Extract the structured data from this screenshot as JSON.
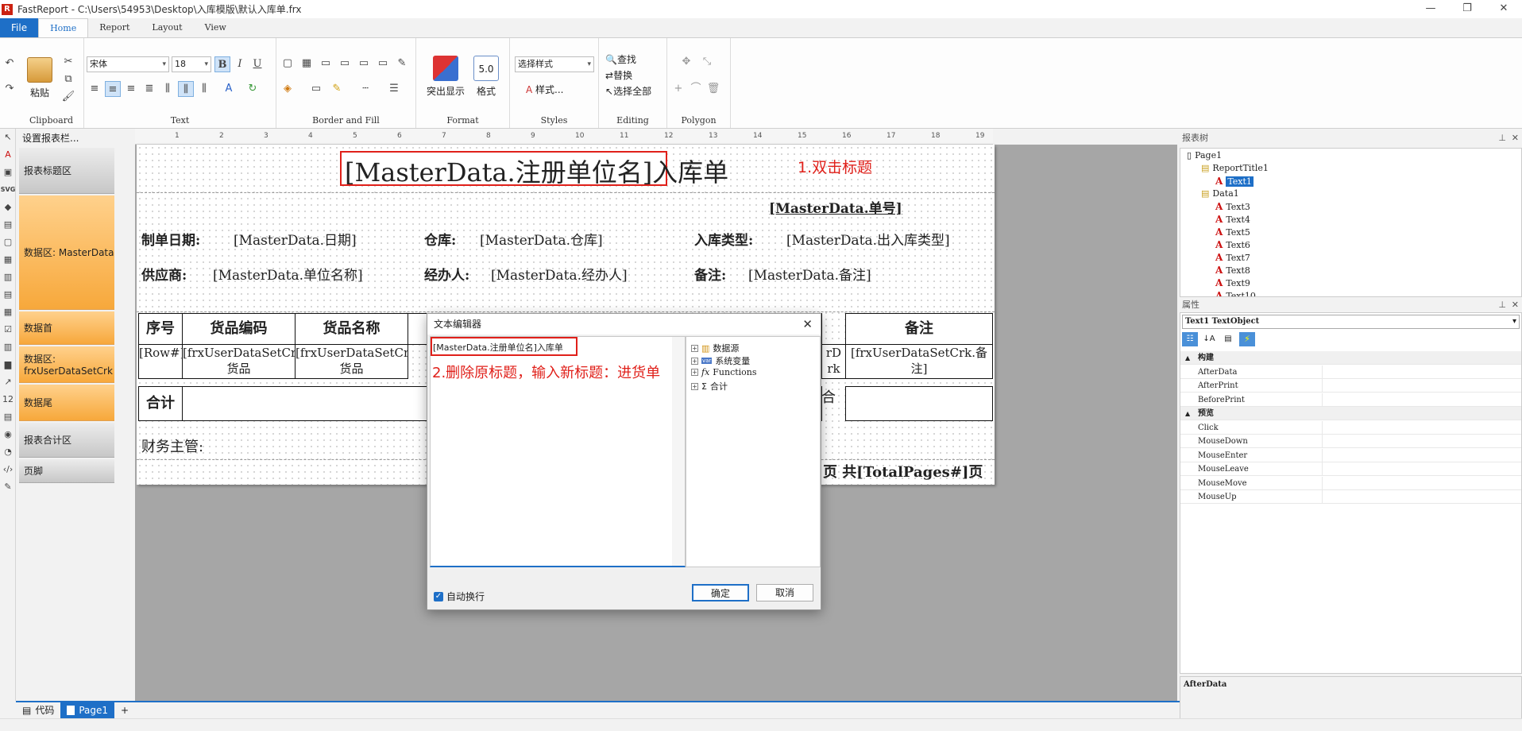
{
  "window": {
    "title": "FastReport - C:\\Users\\54953\\Desktop\\入库模版\\默认入库单.frx",
    "logo": "R",
    "controls": {
      "minimize": "—",
      "maximize": "❐",
      "close": "✕"
    }
  },
  "menu": {
    "tabs": [
      "File",
      "Home",
      "Report",
      "Layout",
      "View"
    ],
    "active": "Home"
  },
  "ribbon": {
    "clipboard": {
      "label": "Clipboard",
      "paste": "粘贴"
    },
    "text": {
      "label": "Text",
      "font": "宋体",
      "size": "18",
      "bold": "B",
      "italic": "I",
      "underline": "U"
    },
    "border": {
      "label": "Border and Fill"
    },
    "format": {
      "label": "Format",
      "highlight": "突出显示",
      "format": "格式"
    },
    "styles": {
      "label": "Styles",
      "select_style": "选择样式",
      "styles_btn": "样式..."
    },
    "editing": {
      "label": "Editing",
      "find": "查找",
      "replace": "替换",
      "select_all": "选择全部"
    },
    "polygon": {
      "label": "Polygon"
    }
  },
  "left_tools": [
    "↖",
    "A",
    "▣",
    "SVG",
    "◆",
    "▤",
    "▢",
    "▦",
    "▥",
    "▤",
    "▦",
    "☑",
    "▥",
    "▆",
    "↗",
    "12",
    "▤",
    "◉",
    "◔",
    "‹/›",
    "✎"
  ],
  "band_panel": {
    "header": "设置报表栏...",
    "bands": [
      {
        "label": "报表标题区",
        "style": "g"
      },
      {
        "label": "数据区: MasterData",
        "style": "o"
      },
      {
        "label": "数据首",
        "style": "o"
      },
      {
        "label": "数据区: frxUserDataSetCrk",
        "style": "o"
      },
      {
        "label": "数据尾",
        "style": "o"
      },
      {
        "label": "报表合计区",
        "style": "g"
      },
      {
        "label": "页脚",
        "style": "g"
      }
    ]
  },
  "ruler": {
    "ticks": [
      "1",
      "2",
      "3",
      "4",
      "5",
      "6",
      "7",
      "8",
      "9",
      "10",
      "11",
      "12",
      "13",
      "14",
      "15",
      "16",
      "17",
      "18",
      "19"
    ]
  },
  "report": {
    "title": "[MasterData.注册单位名]入库单",
    "order_no": "[MasterData.单号]",
    "date_label": "制单日期:",
    "date_value": "[MasterData.日期]",
    "warehouse_label": "仓库:",
    "warehouse_value": "[MasterData.仓库]",
    "type_label": "入库类型:",
    "type_value": "[MasterData.出入库类型]",
    "supplier_label": "供应商:",
    "supplier_value": "[MasterData.单位名称]",
    "handler_label": "经办人:",
    "handler_value": "[MasterData.经办人]",
    "remark_label": "备注:",
    "remark_value": "[MasterData.备注]",
    "table_headers": [
      "序号",
      "货品编码",
      "货品名称",
      "备注"
    ],
    "row_cells": [
      "[Row#]",
      "[frxUserDataSetCrk.货品",
      "[frxUserDataSetCrk.货品",
      "[frxUserDataSetCrk.备注]"
    ],
    "row_cell_partial": "rD rk",
    "total_label": "合计",
    "total_partial": "合",
    "finance_label": "财务主管:",
    "page_footer": "页 共[TotalPages#]页"
  },
  "annotations": {
    "step1": "1.双击标题",
    "step2": "2.删除原标题，输入新标题：进货单"
  },
  "dialog": {
    "title": "文本编辑器",
    "content": "[MasterData.注册单位名]入库单",
    "tree": [
      "数据源",
      "系统变量",
      "Functions",
      "合计"
    ],
    "autowrap_label": "自动换行",
    "ok": "确定",
    "cancel": "取消"
  },
  "report_tree": {
    "header": "报表树",
    "items": [
      {
        "label": "Page1",
        "indent": 0
      },
      {
        "label": "ReportTitle1",
        "indent": 1
      },
      {
        "label": "Text1",
        "indent": 2,
        "selected": true
      },
      {
        "label": "Data1",
        "indent": 1
      },
      {
        "label": "Text3",
        "indent": 2
      },
      {
        "label": "Text4",
        "indent": 2
      },
      {
        "label": "Text5",
        "indent": 2
      },
      {
        "label": "Text6",
        "indent": 2
      },
      {
        "label": "Text7",
        "indent": 2
      },
      {
        "label": "Text8",
        "indent": 2
      },
      {
        "label": "Text9",
        "indent": 2
      },
      {
        "label": "Text10",
        "indent": 2
      }
    ]
  },
  "properties": {
    "header": "属性",
    "object": "Text1 TextObject",
    "rows": [
      {
        "name": "构建",
        "cat": true
      },
      {
        "name": "AfterData"
      },
      {
        "name": "AfterPrint"
      },
      {
        "name": "BeforePrint"
      },
      {
        "name": "预览",
        "cat": true
      },
      {
        "name": "Click"
      },
      {
        "name": "MouseDown"
      },
      {
        "name": "MouseEnter"
      },
      {
        "name": "MouseLeave"
      },
      {
        "name": "MouseMove"
      },
      {
        "name": "MouseUp"
      }
    ],
    "description": "AfterData"
  },
  "bottom_tabs": {
    "code": "代码",
    "page": "Page1",
    "add": "+"
  },
  "colors": {
    "accent": "#1e6fc7",
    "band_orange": "#f7a83b",
    "annotation_red": "#e0201a",
    "canvas": "#a6a6a6"
  }
}
